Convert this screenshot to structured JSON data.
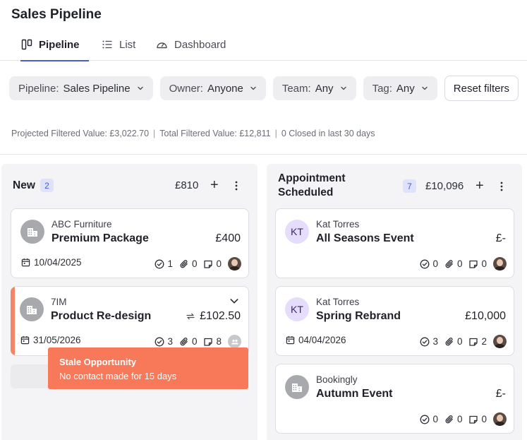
{
  "page": {
    "title": "Sales Pipeline"
  },
  "tabs": [
    {
      "label": "Pipeline",
      "icon": "columns-icon",
      "active": true
    },
    {
      "label": "List",
      "icon": "list-icon",
      "active": false
    },
    {
      "label": "Dashboard",
      "icon": "gauge-icon",
      "active": false
    }
  ],
  "filters": {
    "pipeline": {
      "label": "Pipeline:",
      "value": "Sales Pipeline"
    },
    "owner": {
      "label": "Owner:",
      "value": "Anyone"
    },
    "team": {
      "label": "Team:",
      "value": "Any"
    },
    "tag": {
      "label": "Tag:",
      "value": "Any"
    },
    "reset_label": "Reset filters"
  },
  "summary": {
    "projected": "Projected Filtered Value: £3,022.70",
    "separator": "|",
    "total": "Total Filtered Value: £12,811",
    "closed": "0 Closed in last 30 days"
  },
  "columns": [
    {
      "title": "New",
      "count": "2",
      "total": "£810",
      "add_label": "+",
      "cards": [
        {
          "company": "ABC Furniture",
          "deal": "Premium Package",
          "value": "£400",
          "date": "10/04/2025",
          "tasks": "1",
          "attachments": "0",
          "notes": "0",
          "avatar": "building-icon"
        },
        {
          "company": "7IM",
          "deal": "Product Re-design",
          "value": "£102.50",
          "date": "31/05/2026",
          "tasks": "3",
          "attachments": "0",
          "notes": "8",
          "avatar": "building-icon",
          "recurring": true,
          "stale": true
        }
      ]
    },
    {
      "title_line1": "Appointment",
      "title_line2": "Scheduled",
      "count": "7",
      "total": "£10,096",
      "add_label": "+",
      "cards": [
        {
          "company": "Kat Torres",
          "deal": "All Seasons Event",
          "value": "£-",
          "initials": "KT",
          "tasks": "0",
          "attachments": "0",
          "notes": "0"
        },
        {
          "company": "Kat Torres",
          "deal": "Spring Rebrand",
          "value": "£10,000",
          "initials": "KT",
          "date": "04/04/2026",
          "tasks": "3",
          "attachments": "0",
          "notes": "2"
        },
        {
          "company": "Bookingly",
          "deal": "Autumn Event",
          "value": "£-",
          "avatar": "building-icon",
          "tasks": "0",
          "attachments": "0",
          "notes": "0"
        }
      ]
    }
  ],
  "tooltip": {
    "title": "Stale Opportunity",
    "message": "No contact made for 15 days"
  },
  "colors": {
    "accent": "#4a5bd8",
    "stale": "#f7795a",
    "count_bg": "#dfe2fb",
    "avatar_kt_bg": "#e6dcfb"
  }
}
